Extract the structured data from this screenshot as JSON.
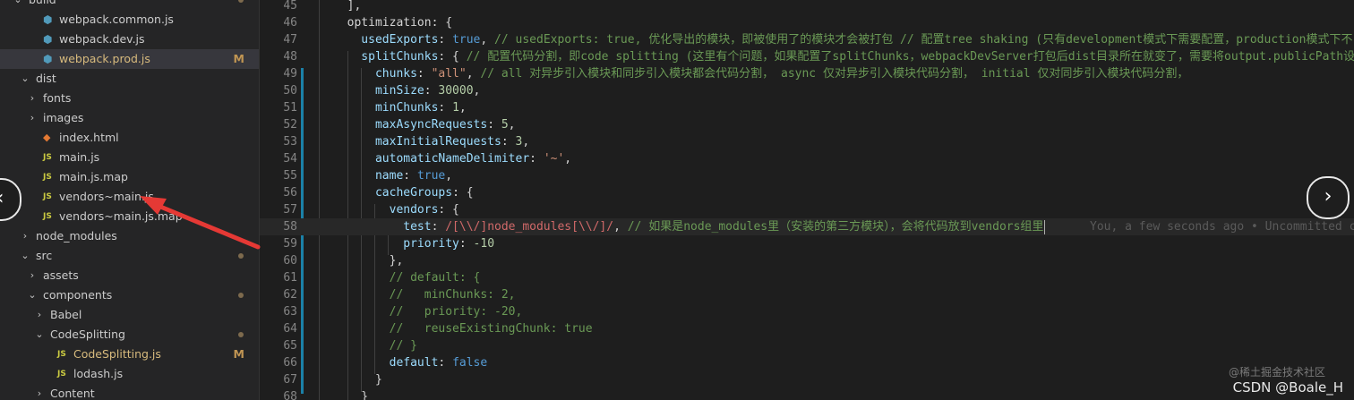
{
  "explorer": {
    "items": [
      {
        "label": "build",
        "type": "folder-open",
        "indent": 0,
        "status": "dot"
      },
      {
        "label": "webpack.common.js",
        "type": "cube",
        "indent": 2
      },
      {
        "label": "webpack.dev.js",
        "type": "cube",
        "indent": 2
      },
      {
        "label": "webpack.prod.js",
        "type": "cube",
        "indent": 2,
        "status": "M",
        "selected": true
      },
      {
        "label": "dist",
        "type": "folder-open",
        "indent": 1
      },
      {
        "label": "fonts",
        "type": "folder",
        "indent": 2
      },
      {
        "label": "images",
        "type": "folder",
        "indent": 2
      },
      {
        "label": "index.html",
        "type": "html",
        "indent": 2
      },
      {
        "label": "main.js",
        "type": "js",
        "indent": 2
      },
      {
        "label": "main.js.map",
        "type": "js",
        "indent": 2
      },
      {
        "label": "vendors~main.js",
        "type": "js",
        "indent": 2
      },
      {
        "label": "vendors~main.js.map",
        "type": "js",
        "indent": 2
      },
      {
        "label": "node_modules",
        "type": "folder",
        "indent": 1
      },
      {
        "label": "src",
        "type": "folder-open",
        "indent": 1,
        "status": "dot"
      },
      {
        "label": "assets",
        "type": "folder",
        "indent": 2
      },
      {
        "label": "components",
        "type": "folder-open",
        "indent": 2,
        "status": "dot"
      },
      {
        "label": "Babel",
        "type": "folder",
        "indent": 3
      },
      {
        "label": "CodeSplitting",
        "type": "folder-open",
        "indent": 3,
        "status": "dot"
      },
      {
        "label": "CodeSplitting.js",
        "type": "js",
        "indent": 4,
        "status": "M"
      },
      {
        "label": "lodash.js",
        "type": "js",
        "indent": 4
      },
      {
        "label": "Content",
        "type": "folder",
        "indent": 3
      }
    ],
    "js_icon_text": "JS"
  },
  "editor": {
    "lines": [
      {
        "n": "45",
        "tokens": [
          [
            "p",
            "  ],"
          ]
        ]
      },
      {
        "n": "46",
        "tokens": [
          [
            "p",
            "  optimization: {"
          ]
        ]
      },
      {
        "n": "47",
        "tokens": [
          [
            "k",
            "    usedExports"
          ],
          [
            "p",
            ": "
          ],
          [
            "b",
            "true"
          ],
          [
            "p",
            ", "
          ],
          [
            "c",
            "// usedExports: true, 优化导出的模块，即被使用了的模块才会被打包 // 配置tree shaking (只有development模式下需要配置，production模式下不"
          ]
        ]
      },
      {
        "n": "48",
        "tokens": [
          [
            "k",
            "    splitChunks"
          ],
          [
            "p",
            ": { "
          ],
          [
            "c",
            "// 配置代码分割，即code splitting (这里有个问题，如果配置了splitChunks，webpackDevServer打包后dist目录所在就变了，需要将output.publicPath设"
          ]
        ]
      },
      {
        "n": "49",
        "tokens": [
          [
            "k",
            "      chunks"
          ],
          [
            "p",
            ": "
          ],
          [
            "s",
            "\"all\""
          ],
          [
            "p",
            ", "
          ],
          [
            "c",
            "// all 对异步引入模块和同步引入模块都会代码分割， async 仅对异步引入模块代码分割， initial 仅对同步引入模块代码分割，"
          ]
        ]
      },
      {
        "n": "50",
        "tokens": [
          [
            "k",
            "      minSize"
          ],
          [
            "p",
            ": "
          ],
          [
            "n",
            "30000"
          ],
          [
            "p",
            ","
          ]
        ]
      },
      {
        "n": "51",
        "tokens": [
          [
            "k",
            "      minChunks"
          ],
          [
            "p",
            ": "
          ],
          [
            "n",
            "1"
          ],
          [
            "p",
            ","
          ]
        ]
      },
      {
        "n": "52",
        "tokens": [
          [
            "k",
            "      maxAsyncRequests"
          ],
          [
            "p",
            ": "
          ],
          [
            "n",
            "5"
          ],
          [
            "p",
            ","
          ]
        ]
      },
      {
        "n": "53",
        "tokens": [
          [
            "k",
            "      maxInitialRequests"
          ],
          [
            "p",
            ": "
          ],
          [
            "n",
            "3"
          ],
          [
            "p",
            ","
          ]
        ]
      },
      {
        "n": "54",
        "tokens": [
          [
            "k",
            "      automaticNameDelimiter"
          ],
          [
            "p",
            ": "
          ],
          [
            "s",
            "'~'"
          ],
          [
            "p",
            ","
          ]
        ]
      },
      {
        "n": "55",
        "tokens": [
          [
            "k",
            "      name"
          ],
          [
            "p",
            ": "
          ],
          [
            "b",
            "true"
          ],
          [
            "p",
            ","
          ]
        ]
      },
      {
        "n": "56",
        "tokens": [
          [
            "k",
            "      cacheGroups"
          ],
          [
            "p",
            ": {"
          ]
        ]
      },
      {
        "n": "57",
        "tokens": [
          [
            "k",
            "        vendors"
          ],
          [
            "p",
            ": {"
          ]
        ]
      },
      {
        "n": "58",
        "tokens": [
          [
            "k",
            "          test"
          ],
          [
            "p",
            ": "
          ],
          [
            "rg",
            "/[\\\\/]node_modules[\\\\/]/"
          ],
          [
            "p",
            ", "
          ],
          [
            "c",
            "// 如果是node_modules里（安装的第三方模块），会将代码放到vendors组里"
          ]
        ],
        "blame": "You, a few seconds ago • Uncommitted ch",
        "current": true
      },
      {
        "n": "59",
        "tokens": [
          [
            "k",
            "          priority"
          ],
          [
            "p",
            ": "
          ],
          [
            "n",
            "-10"
          ]
        ]
      },
      {
        "n": "60",
        "tokens": [
          [
            "p",
            "        },"
          ]
        ]
      },
      {
        "n": "61",
        "tokens": [
          [
            "c",
            "        // default: {"
          ]
        ]
      },
      {
        "n": "62",
        "tokens": [
          [
            "c",
            "        //   minChunks: 2,"
          ]
        ]
      },
      {
        "n": "63",
        "tokens": [
          [
            "c",
            "        //   priority: -20,"
          ]
        ]
      },
      {
        "n": "64",
        "tokens": [
          [
            "c",
            "        //   reuseExistingChunk: true"
          ]
        ]
      },
      {
        "n": "65",
        "tokens": [
          [
            "c",
            "        // }"
          ]
        ]
      },
      {
        "n": "66",
        "tokens": [
          [
            "k",
            "        default"
          ],
          [
            "p",
            ": "
          ],
          [
            "b",
            "false"
          ]
        ]
      },
      {
        "n": "67",
        "tokens": [
          [
            "p",
            "      }"
          ]
        ]
      },
      {
        "n": "68",
        "tokens": [
          [
            "p",
            "    }"
          ]
        ]
      }
    ]
  },
  "watermark": {
    "main": "CSDN @Boale_H",
    "secondary": "@稀土掘金技术社区"
  },
  "nav": {
    "prev": "‹",
    "next": "›"
  },
  "colors": {
    "arrow": "#e53935",
    "selected": "#37373d",
    "modified": "#c09553"
  }
}
